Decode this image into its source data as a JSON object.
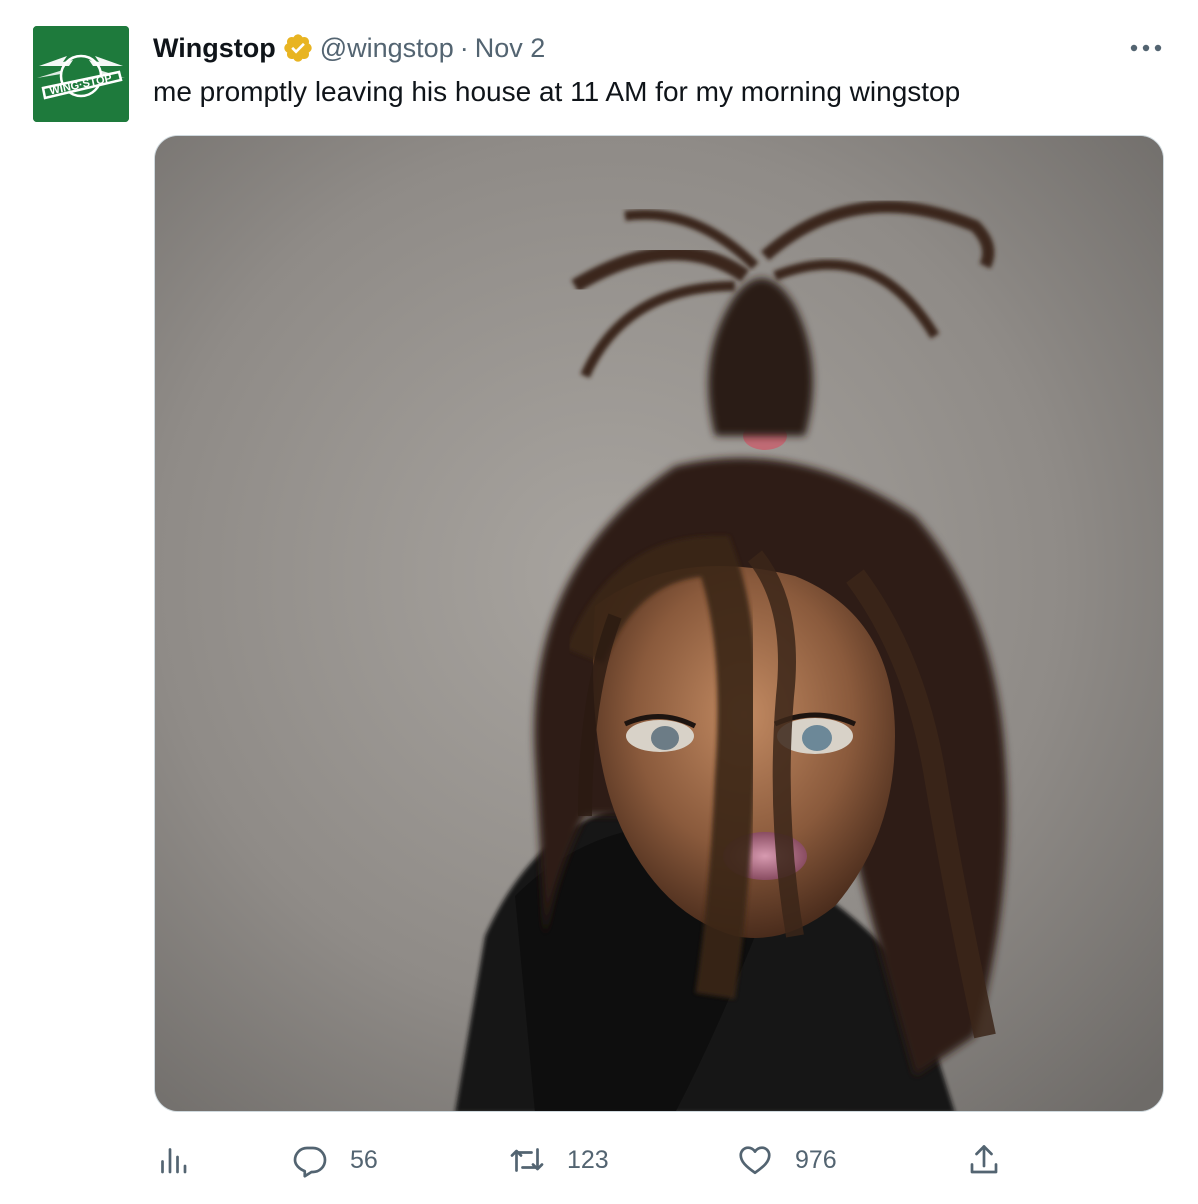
{
  "tweet": {
    "author_name": "Wingstop",
    "handle": "@wingstop",
    "separator": "·",
    "date": "Nov 2",
    "text": "me promptly leaving his house at 11 AM for my morning wingstop",
    "verified": true
  },
  "avatar": {
    "logo_text": "WING·STOP",
    "background_color": "#1e7a3c"
  },
  "actions": {
    "analytics_icon": "analytics-icon",
    "reply_count": "56",
    "retweet_count": "123",
    "like_count": "976",
    "share_icon": "share-icon"
  },
  "colors": {
    "text_primary": "#0f1419",
    "text_secondary": "#536471",
    "verified_badge": "#e8b422",
    "border": "#cfd9de"
  }
}
